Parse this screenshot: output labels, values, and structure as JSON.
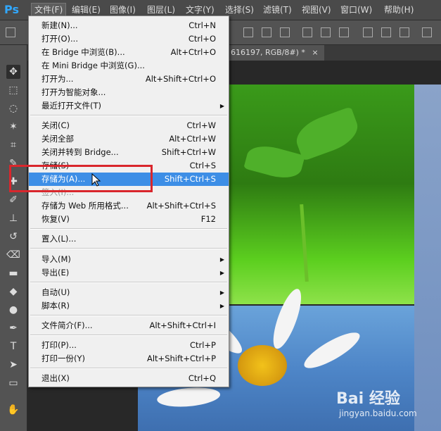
{
  "app": {
    "logo": "Ps"
  },
  "menubar": {
    "items": [
      "文件(F)",
      "编辑(E)",
      "图像(I)",
      "图层(L)",
      "文字(Y)",
      "选择(S)",
      "滤镜(T)",
      "视图(V)",
      "窗口(W)",
      "帮助(H)"
    ]
  },
  "document": {
    "tab_title": "616197, RGB/8#) *",
    "close": "×"
  },
  "file_menu": {
    "items": [
      {
        "label": "新建(N)...",
        "shortcut": "Ctrl+N"
      },
      {
        "label": "打开(O)...",
        "shortcut": "Ctrl+O"
      },
      {
        "label": "在 Bridge 中浏览(B)...",
        "shortcut": "Alt+Ctrl+O"
      },
      {
        "label": "在 Mini Bridge 中浏览(G)...",
        "shortcut": ""
      },
      {
        "label": "打开为...",
        "shortcut": "Alt+Shift+Ctrl+O"
      },
      {
        "label": "打开为智能对象...",
        "shortcut": ""
      },
      {
        "label": "最近打开文件(T)",
        "shortcut": ""
      },
      {
        "label": "关闭(C)",
        "shortcut": "Ctrl+W"
      },
      {
        "label": "关闭全部",
        "shortcut": "Alt+Ctrl+W"
      },
      {
        "label": "关闭并转到 Bridge...",
        "shortcut": "Shift+Ctrl+W"
      },
      {
        "label": "存储(S)",
        "shortcut": "Ctrl+S"
      },
      {
        "label": "存储为(A)...",
        "shortcut": "Shift+Ctrl+S"
      },
      {
        "label": "签入(I)...",
        "shortcut": ""
      },
      {
        "label": "存储为 Web 所用格式...",
        "shortcut": "Alt+Shift+Ctrl+S"
      },
      {
        "label": "恢复(V)",
        "shortcut": "F12"
      },
      {
        "label": "置入(L)...",
        "shortcut": ""
      },
      {
        "label": "导入(M)",
        "shortcut": ""
      },
      {
        "label": "导出(E)",
        "shortcut": ""
      },
      {
        "label": "自动(U)",
        "shortcut": ""
      },
      {
        "label": "脚本(R)",
        "shortcut": ""
      },
      {
        "label": "文件简介(F)...",
        "shortcut": "Alt+Shift+Ctrl+I"
      },
      {
        "label": "打印(P)...",
        "shortcut": "Ctrl+P"
      },
      {
        "label": "打印一份(Y)",
        "shortcut": "Alt+Shift+Ctrl+P"
      },
      {
        "label": "退出(X)",
        "shortcut": "Ctrl+Q"
      }
    ],
    "highlighted": "存储为(A)...",
    "submenu_arrow": "▶"
  },
  "tools": [
    "move-tool",
    "marquee-tool",
    "lasso-tool",
    "magic-wand-tool",
    "crop-tool",
    "eyedropper-tool",
    "healing-brush-tool",
    "brush-tool",
    "clone-stamp-tool",
    "history-brush-tool",
    "eraser-tool",
    "gradient-tool",
    "blur-tool",
    "dodge-tool",
    "pen-tool",
    "type-tool",
    "path-selection-tool",
    "rectangle-tool",
    "hand-tool"
  ],
  "tool_glyphs": [
    "✥",
    "⬚",
    "◌",
    "✶",
    "⌗",
    "✎",
    "✚",
    "✐",
    "⊥",
    "↺",
    "⌫",
    "▬",
    "◆",
    "●",
    "✒",
    "T",
    "➤",
    "▭",
    "✋"
  ],
  "watermark": {
    "text": "Bai 经验",
    "sub": "jingyan.baidu.com"
  }
}
